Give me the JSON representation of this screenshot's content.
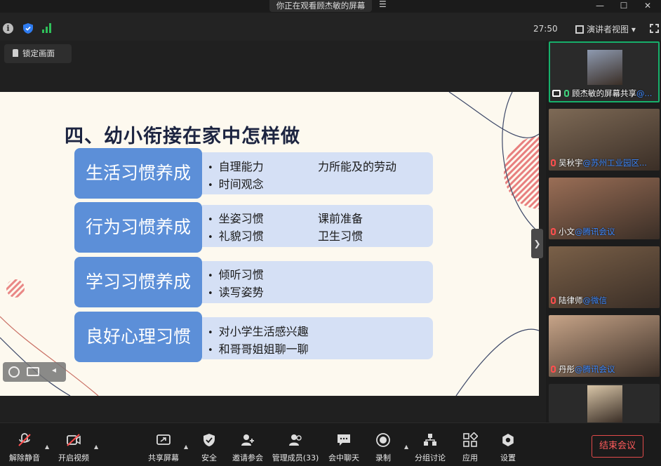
{
  "window": {
    "share_banner": "你正在观看顾杰敏的屏幕"
  },
  "top": {
    "timer": "27:50",
    "view_mode": "演讲者视图 ▾"
  },
  "lock_label": "锁定画面",
  "slide": {
    "title": "四、幼小衔接在家中怎样做",
    "sections": [
      {
        "label": "生活习惯养成",
        "items": [
          "自理能力",
          "时间观念"
        ],
        "items_right": [
          "力所能及的劳动"
        ]
      },
      {
        "label": "行为习惯养成",
        "items": [
          "坐姿习惯",
          "礼貌习惯"
        ],
        "items_right": [
          "课前准备",
          "卫生习惯"
        ]
      },
      {
        "label": "学习习惯养成",
        "items": [
          "倾听习惯",
          "读写姿势"
        ],
        "items_right": []
      },
      {
        "label": "良好心理习惯",
        "items": [
          "对小学生活感兴趣",
          "和哥哥姐姐聊一聊"
        ],
        "items_right": []
      }
    ]
  },
  "participants": [
    {
      "name": "顾杰敏的屏幕共享",
      "suffix": "@...",
      "photo_color": "#8e9ab0"
    },
    {
      "name": "吴秋宇",
      "suffix": "@苏州工业园区...",
      "photo_color": "#7e6a56"
    },
    {
      "name": "小文",
      "suffix": "@腾讯会议",
      "photo_color": "#9a6e56"
    },
    {
      "name": "陆律师",
      "suffix": "@微信",
      "photo_color": "#7a6048"
    },
    {
      "name": "丹彤",
      "suffix": "@腾讯会议",
      "photo_color": "#c7a488"
    },
    {
      "name": "",
      "suffix": "",
      "photo_color": "#d9c6a8"
    }
  ],
  "toolbar": {
    "unmute": "解除静音",
    "video": "开启视频",
    "share": "共享屏幕",
    "security": "安全",
    "invite": "邀请参会",
    "members": "管理成员(33)",
    "chat": "会中聊天",
    "record": "录制",
    "breakout": "分组讨论",
    "apps": "应用",
    "settings": "设置",
    "end": "结束会议"
  }
}
